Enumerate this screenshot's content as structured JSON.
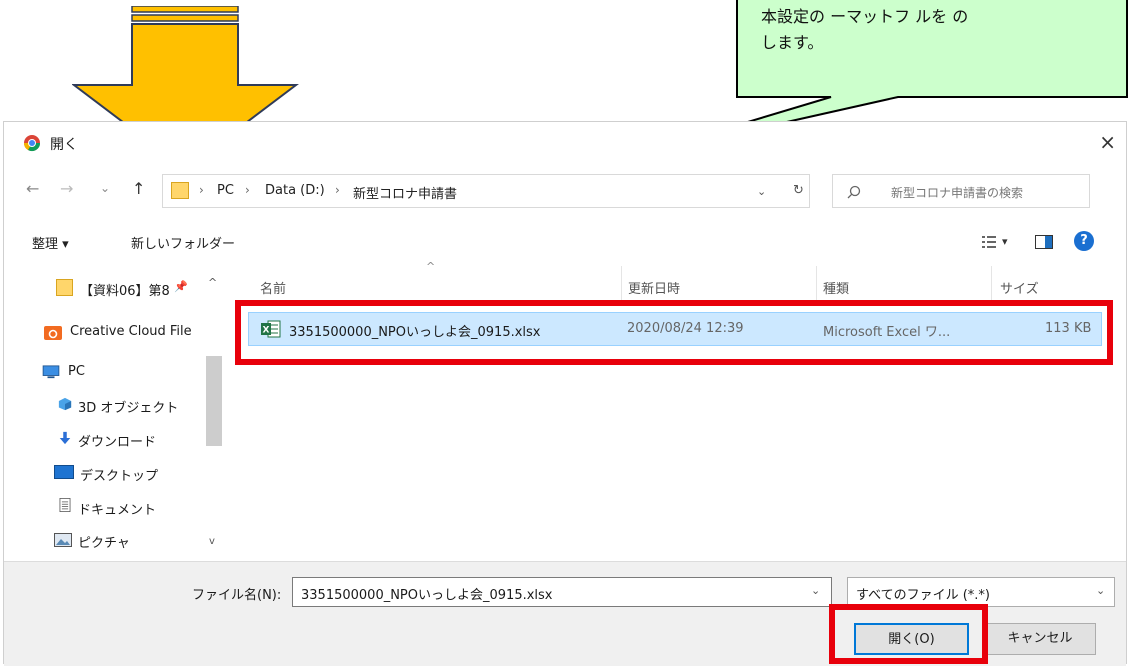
{
  "callout": {
    "text": "本設定の ーマットフ ルを の\nします。"
  },
  "dialog": {
    "title": "開く",
    "close": "×"
  },
  "nav": {
    "back": "←",
    "forward": "→",
    "recent": "⌄",
    "up": "↑",
    "path": [
      "PC",
      "Data (D:)",
      "新型コロナ申請書"
    ],
    "dropdown": "⌄",
    "refresh": "↻",
    "search_placeholder": "新型コロナ申請書の検索"
  },
  "toolbar": {
    "organize": "整理 ▾",
    "new_folder": "新しいフォルダー",
    "view": "▾",
    "help": "?"
  },
  "sidebar": [
    {
      "label": "【資料06】第8",
      "icon": "folder-icon"
    },
    {
      "label": "Creative Cloud File",
      "icon": "creative-cloud-icon"
    },
    {
      "label": "PC",
      "icon": "pc-icon"
    },
    {
      "label": "3D オブジェクト",
      "icon": "3d-objects-icon"
    },
    {
      "label": "ダウンロード",
      "icon": "download-icon"
    },
    {
      "label": "デスクトップ",
      "icon": "desktop-icon"
    },
    {
      "label": "ドキュメント",
      "icon": "documents-icon"
    },
    {
      "label": "ピクチャ",
      "icon": "pictures-icon"
    }
  ],
  "columns": {
    "name": "名前",
    "modified": "更新日時",
    "type": "種類",
    "size": "サイズ"
  },
  "files": [
    {
      "name": "3351500000_NPOいっしよ会_0915.xlsx",
      "modified": "2020/08/24 12:39",
      "type": "Microsoft Excel ワ...",
      "size": "113 KB"
    }
  ],
  "bottom": {
    "filename_label": "ファイル名(N):",
    "filename_value": "3351500000_NPOいっしよ会_0915.xlsx",
    "filetype_value": "すべてのファイル (*.*)",
    "open_label": "開く(O)",
    "cancel_label": "キャンセル"
  },
  "colors": {
    "arrow": "#ffc000",
    "callout": "#ccffcc",
    "highlight": "#e8000b",
    "selection": "#cce8ff"
  }
}
